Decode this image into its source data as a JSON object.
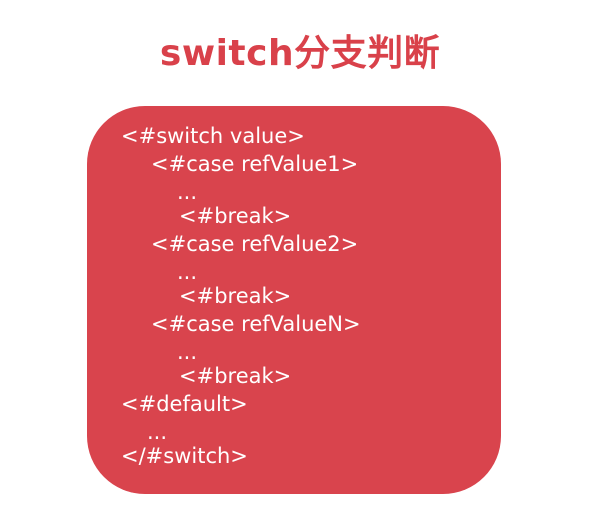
{
  "title": "switch分支判断",
  "code_lines": [
    "<#switch value>",
    "<#case refValue1>",
    "...",
    "<#break>",
    "<#case refValue2>",
    "...",
    "<#break>",
    "<#case refValueN>",
    "...",
    "<#break>",
    "<#default>",
    "...",
    "</#switch>"
  ],
  "colors": {
    "accent": "#d9414a",
    "box_background": "#d9444d",
    "code_text": "#ffffff",
    "page_background": "#ffffff"
  }
}
